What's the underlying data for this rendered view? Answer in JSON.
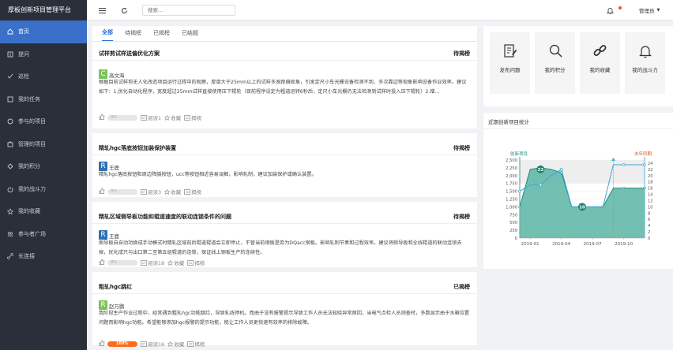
{
  "app": {
    "title": "厚板创新项目管理平台"
  },
  "sidebar": {
    "items": [
      {
        "label": "首页",
        "icon": "home-icon",
        "active": true
      },
      {
        "label": "提问",
        "icon": "edit-icon"
      },
      {
        "label": "巡检",
        "icon": "check-icon"
      },
      {
        "label": "我的任务",
        "icon": "task-icon"
      },
      {
        "label": "参与的项目",
        "icon": "project-icon"
      },
      {
        "label": "管理的项目",
        "icon": "manage-icon"
      },
      {
        "label": "我的积分",
        "icon": "points-icon"
      },
      {
        "label": "我的战斗力",
        "icon": "power-icon"
      },
      {
        "label": "我的收藏",
        "icon": "favorite-icon"
      },
      {
        "label": "参与者广场",
        "icon": "square-icon"
      },
      {
        "label": "长连接",
        "icon": "link-icon"
      }
    ]
  },
  "topbar": {
    "search_placeholder": "搜索...",
    "user": "管理员"
  },
  "tabs": [
    "全部",
    "待揭榜",
    "已揭榜",
    "已结题"
  ],
  "cards": [
    {
      "title": "试样剪试样送偏优化方案",
      "status": "待揭榜",
      "avatar_letter": "C",
      "avatar_color": "#7cc35a",
      "author": "高文海",
      "desc": "根据目前试样剪无人化改造项目运行过程中的观察，厚度大于25mm以上的试样多发跑偏现象，引发定尺小车光栅设备检测不到、多次靠边等现象影响设备作业效率。建议如下：1.优化自动化程序，宽度超过25mm试样直接使用压下辊轮（目前程序设定为粗道运转6秒后，定尺小车光栅仍无法检测到试样时投入压下辊轮）2.增...",
      "progress_label": "0%",
      "progress": 0,
      "reads": "阅读1",
      "fav": "收藏",
      "list": "揭榜"
    },
    {
      "title": "精轧hgc落底按钮加装保护装置",
      "status": "待揭榜",
      "avatar_letter": "R",
      "avatar_color": "#2f6fb5",
      "author": "王鹿",
      "desc": "精轧hgc落底按钮和周边降龋按钮，ucc等按钮相近容易误触，影响轧制，建议加装保护或确认装置。",
      "progress_label": "0%",
      "progress": 0,
      "reads": "阅读3",
      "fav": "收藏",
      "list": "揭榜"
    },
    {
      "title": "精轧区域侧导板功能和辊道速度的联动连锁条件的问题",
      "status": "待揭榜",
      "avatar_letter": "R",
      "avatar_color": "#2f6fb5",
      "author": "王鹿",
      "desc": "侧导板自自动功换成手动模式时精轧区域前后辊道辊道会立即停止，不管当前钢板是否为DQacc钢板。影响轧制节奏和过程效率。建议将侧导板和全线辊道的联动连锁去掉，优化成只与出口第二至第五组辊道的连锁，保证线上钢板生产的连续性。",
      "progress_label": "0%",
      "progress": 0,
      "reads": "阅读18",
      "fav": "收藏",
      "list": "揭榜"
    },
    {
      "title": "粗轧hgc跳红",
      "status": "已揭榜",
      "avatar_letter": "R",
      "avatar_color": "#7cc35a",
      "author": "赵万鹏",
      "desc": "我阶段生产作业过程中，经常遇到粗轧hgc功能跳红，导致轧线停机。而由于没有报警提示导致工作人员无法知晓异常原因，当电气点检人员测查时，多数显示由于水箱位置问题而影响hgc功能。希望能够添加hgc报警的提示功能，能让工作人员更快速有效率的排除故障。",
      "progress_label": "100%",
      "progress": 1,
      "reads": "阅读16",
      "fav": "收藏",
      "list": "揭榜"
    }
  ],
  "quick_actions": [
    {
      "label": "发布问题",
      "icon": "publish-icon"
    },
    {
      "label": "我的积分",
      "icon": "search-icon"
    },
    {
      "label": "我的收藏",
      "icon": "link-icon"
    },
    {
      "label": "我的战斗力",
      "icon": "bell-icon"
    }
  ],
  "chart_panel": {
    "title": "近期创新项目统计"
  },
  "chart_data": {
    "type": "line",
    "left_axis_label": "创新项目",
    "right_axis_label": "去年同期",
    "left_ylim": [
      0,
      2500
    ],
    "left_ticks": [
      0,
      250,
      500,
      750,
      1000,
      1250,
      1500,
      1750,
      2000,
      2250,
      2500
    ],
    "right_ylim": [
      0,
      25
    ],
    "right_ticks": [
      0,
      2,
      4,
      6,
      8,
      10,
      12,
      14,
      16,
      18,
      20,
      22,
      24
    ],
    "x_ticks": [
      "2019-01",
      "2019-04",
      "2019-07",
      "2019-10"
    ],
    "series": [
      {
        "name": "创新项目",
        "color": "#1c8c7a",
        "x": [
          "2018-12",
          "2019-01",
          "2019-02",
          "2019-03",
          "2019-04",
          "2019-05",
          "2019-06",
          "2019-07",
          "2019-08",
          "2019-09",
          "2019-10",
          "2019-11",
          "2019-12"
        ],
        "values": [
          1000,
          2200,
          2250,
          2200,
          2100,
          1000,
          1000,
          1000,
          1000,
          1600,
          1600,
          1600,
          1600
        ]
      },
      {
        "name": "去年同期",
        "color": "#39a6d8",
        "x": [
          "2018-12",
          "2019-01",
          "2019-02",
          "2019-03",
          "2019-04",
          "2019-05",
          "2019-06",
          "2019-07",
          "2019-08",
          "2019-09",
          "2019-10",
          "2019-11",
          "2019-12"
        ],
        "values": [
          15,
          17,
          17,
          20,
          22,
          10,
          10,
          10,
          10,
          23.5,
          23.5,
          23.5,
          23.5
        ]
      }
    ],
    "labels": [
      {
        "value": "22",
        "series": "创新项目",
        "x": "2019-02"
      },
      {
        "value": "10",
        "series": "创新项目",
        "x": "2019-06"
      }
    ],
    "marker_line": {
      "x": "2019-09",
      "color": "#1fc6c6"
    }
  }
}
